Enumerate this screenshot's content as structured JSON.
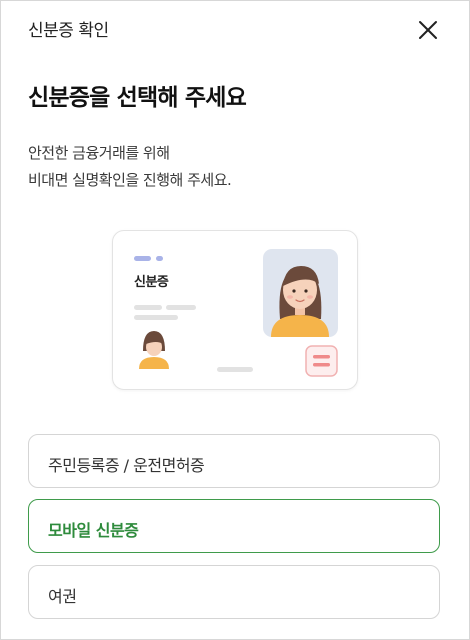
{
  "header": {
    "title": "신분증 확인",
    "close_icon": "close-icon"
  },
  "main": {
    "heading": "신분증을 선택해 주세요",
    "description_lines": [
      "안전한 금융거래를 위해",
      "비대면 실명확인을 진행해 주세요."
    ],
    "illustration": {
      "card_label": "신분증"
    },
    "options": [
      {
        "label": "주민등록증 / 운전면허증",
        "selected": false
      },
      {
        "label": "모바일 신분증",
        "selected": true
      },
      {
        "label": "여권",
        "selected": false
      }
    ]
  },
  "colors": {
    "accent": "#3f9b4b",
    "accent_text": "#2e8b3c",
    "border": "#d5d5d5"
  }
}
